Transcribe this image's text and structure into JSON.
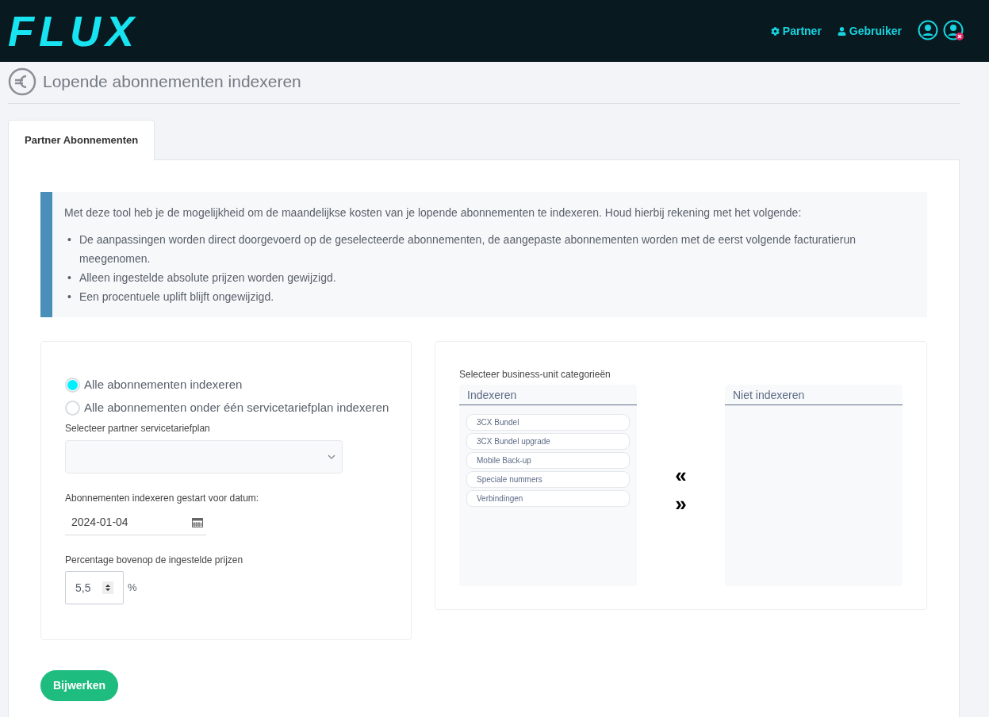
{
  "header": {
    "logo": "FLUX",
    "nav": [
      {
        "kind": "gear",
        "label": "Partner"
      },
      {
        "kind": "user",
        "label": "Gebruiker"
      }
    ]
  },
  "page_title": "Lopende abonnementen indexeren",
  "tabs": [
    {
      "label": "Partner Abonnementen",
      "selected": true
    }
  ],
  "info": {
    "marker": "•",
    "intro": "Met deze tool heb je de mogelijkheid om de maandelijkse kosten van je lopende abonnementen te indexeren. Houd hierbij rekening met het volgende:",
    "bullets": [
      "De aanpassingen worden direct doorgevoerd op de geselecteerde abonnementen, de aangepaste abonnementen worden met de eerst volgende facturatierun meegenomen.",
      "Alleen ingestelde absolute prijzen worden gewijzigd.",
      "Een procentuele uplift blijft ongewijzigd."
    ]
  },
  "options": [
    {
      "label": "Alle abonnementen indexeren",
      "selected": true
    },
    {
      "label": "Alle abonnementen onder één servicetariefplan indexeren",
      "selected": false
    }
  ],
  "plan_label": "Selecteer partner servicetariefplan",
  "date_label": "Abonnementen indexeren gestart voor datum:",
  "date_value": "2024-01-04",
  "percent_label": "Percentage bovenop de ingestelde prijzen",
  "percent_value": "5,5",
  "percent_unit": "%",
  "categories": {
    "label": "Selecteer business-unit categorieën",
    "left_title": "Indexeren",
    "left_items": [
      "3CX Bundel",
      "3CX Bundel upgrade",
      "Mobile Back-up",
      "Speciale nummers",
      "Verbindingen"
    ],
    "move_left": "«",
    "move_right": "»",
    "right_title": "Niet indexeren"
  },
  "submit": "Bijwerken"
}
